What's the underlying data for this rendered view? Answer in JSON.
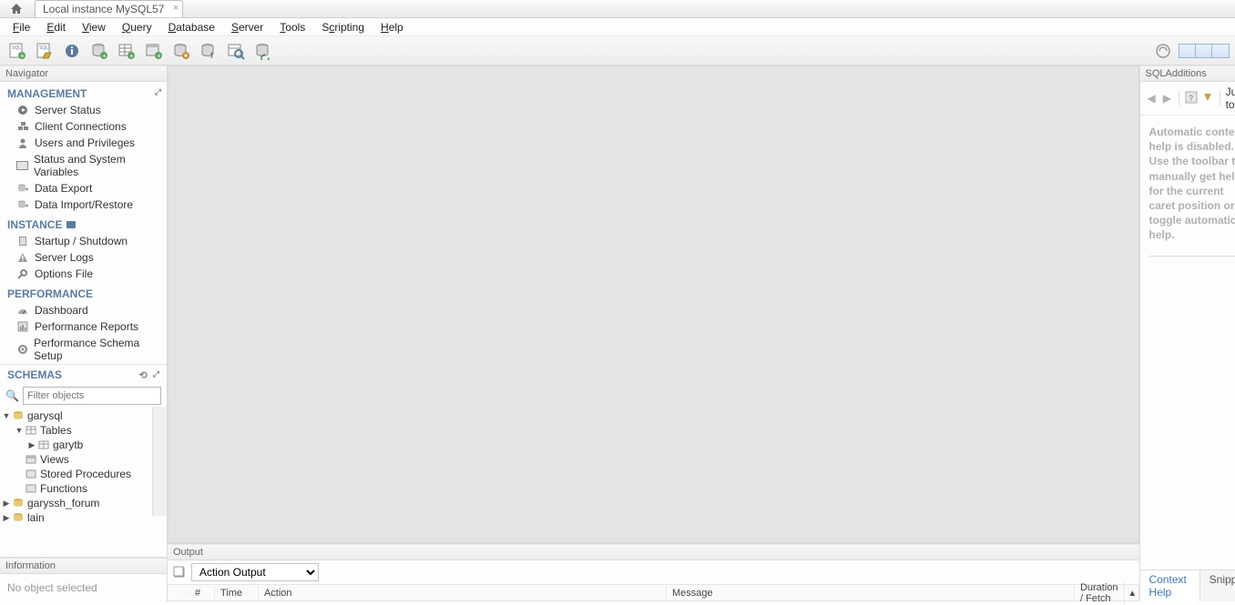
{
  "tab": {
    "title": "Local instance MySQL57"
  },
  "menu": [
    "File",
    "Edit",
    "View",
    "Query",
    "Database",
    "Server",
    "Tools",
    "Scripting",
    "Help"
  ],
  "navigator": {
    "title": "Navigator",
    "management_label": "MANAGEMENT",
    "management": [
      "Server Status",
      "Client Connections",
      "Users and Privileges",
      "Status and System Variables",
      "Data Export",
      "Data Import/Restore"
    ],
    "instance_label": "INSTANCE",
    "instance": [
      "Startup / Shutdown",
      "Server Logs",
      "Options File"
    ],
    "performance_label": "PERFORMANCE",
    "performance": [
      "Dashboard",
      "Performance Reports",
      "Performance Schema Setup"
    ],
    "schemas_label": "SCHEMAS",
    "filter_placeholder": "Filter objects",
    "tree": {
      "db1": "garysql",
      "db1_tables": "Tables",
      "db1_table1": "garytb",
      "db1_views": "Views",
      "db1_sp": "Stored Procedures",
      "db1_fn": "Functions",
      "db2": "garyssh_forum",
      "db3": "lain"
    }
  },
  "information": {
    "title": "Information",
    "body": "No object selected"
  },
  "output": {
    "title": "Output",
    "selector": "Action Output",
    "cols": {
      "num": "#",
      "time": "Time",
      "action": "Action",
      "message": "Message",
      "duration": "Duration / Fetch"
    }
  },
  "sqladd": {
    "title": "SQLAdditions",
    "jump": "Jump to",
    "help": "Automatic context help is disabled. Use the toolbar to manually get help for the current caret position or to toggle automatic help.",
    "tab_context": "Context Help",
    "tab_snippets": "Snippets"
  }
}
